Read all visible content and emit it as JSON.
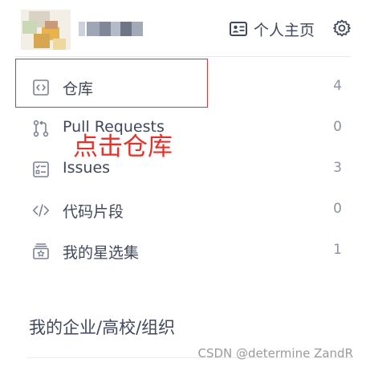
{
  "header": {
    "home_label": "个人主页"
  },
  "nav": {
    "items": [
      {
        "label": "仓库",
        "count": "4",
        "icon": "code-repo-icon"
      },
      {
        "label": "Pull Requests",
        "count": "0",
        "icon": "pull-request-icon"
      },
      {
        "label": "Issues",
        "count": "3",
        "icon": "issues-icon"
      },
      {
        "label": "代码片段",
        "count": "0",
        "icon": "code-snippet-icon"
      },
      {
        "label": "我的星选集",
        "count": "1",
        "icon": "star-collection-icon"
      }
    ]
  },
  "annotation": {
    "text": "点击仓库",
    "color": "#e3322b"
  },
  "section": {
    "title": "我的企业/高校/组织"
  },
  "watermark": {
    "text": "CSDN @determine  ZandR"
  },
  "colors": {
    "text": "#40485b",
    "count": "#8c92a4",
    "highlight": "#d23b38"
  }
}
